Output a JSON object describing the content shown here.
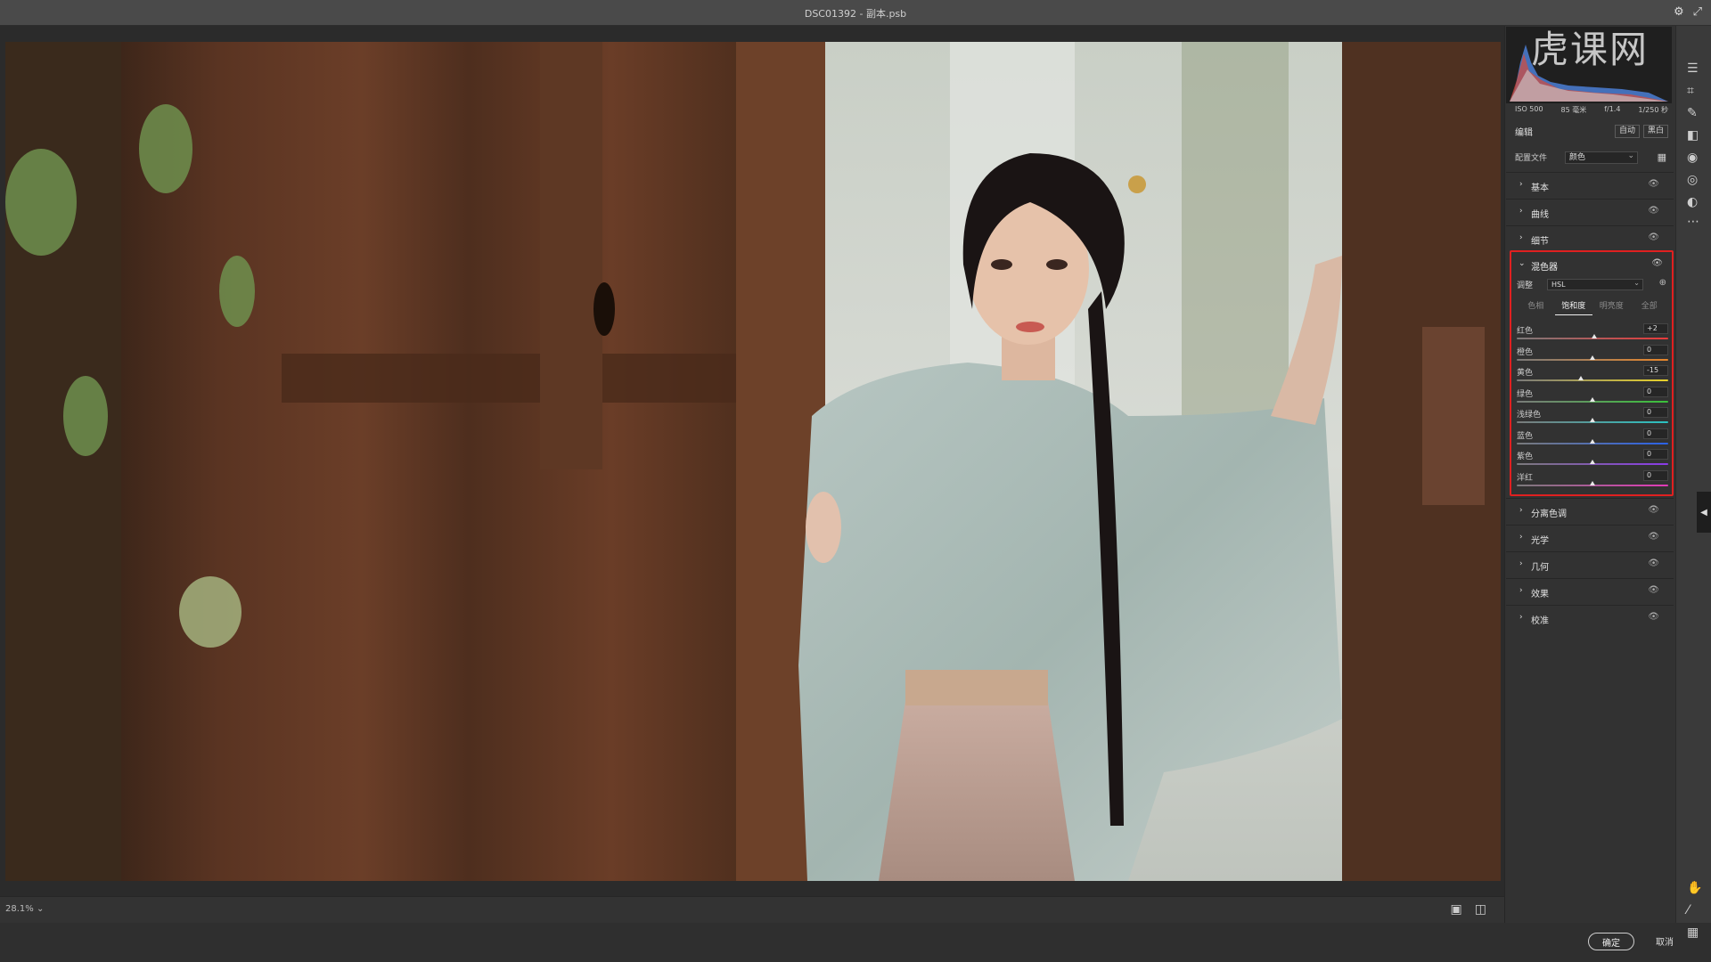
{
  "window": {
    "title": "DSC01392 - 副本.psb"
  },
  "watermark": "虎课网",
  "zoom": "28.1%",
  "exif": [
    "ISO 500",
    "85 毫米",
    "f/1.4",
    "1/250 秒"
  ],
  "panel": {
    "edit_label": "编辑",
    "auto_label": "自动",
    "bw_label": "黑白",
    "profile_label": "配置文件",
    "profile_value": "颜色",
    "sections_top": [
      {
        "label": "基本"
      },
      {
        "label": "曲线"
      },
      {
        "label": "细节"
      }
    ],
    "mixer": {
      "label": "混色器",
      "adjust_label": "调整",
      "adjust_value": "HSL",
      "tabs": [
        {
          "label": "色相",
          "active": false
        },
        {
          "label": "饱和度",
          "active": true
        },
        {
          "label": "明亮度",
          "active": false
        },
        {
          "label": "全部",
          "active": false
        }
      ],
      "sliders": [
        {
          "name": "红色",
          "value": "+2",
          "pos": 0.51,
          "grad": "linear-gradient(90deg,#7a7a7a,#e83a3a)"
        },
        {
          "name": "橙色",
          "value": "0",
          "pos": 0.5,
          "grad": "linear-gradient(90deg,#7a7a7a,#e8862a)"
        },
        {
          "name": "黄色",
          "value": "-15",
          "pos": 0.425,
          "grad": "linear-gradient(90deg,#7a7a7a,#e8d22a)"
        },
        {
          "name": "绿色",
          "value": "0",
          "pos": 0.5,
          "grad": "linear-gradient(90deg,#7a7a7a,#3ac23a)"
        },
        {
          "name": "浅绿色",
          "value": "0",
          "pos": 0.5,
          "grad": "linear-gradient(90deg,#7a7a7a,#2ac2c2)"
        },
        {
          "name": "蓝色",
          "value": "0",
          "pos": 0.5,
          "grad": "linear-gradient(90deg,#7a7a7a,#2a62e8)"
        },
        {
          "name": "紫色",
          "value": "0",
          "pos": 0.5,
          "grad": "linear-gradient(90deg,#7a7a7a,#8a3ae8)"
        },
        {
          "name": "洋红",
          "value": "0",
          "pos": 0.5,
          "grad": "linear-gradient(90deg,#7a7a7a,#e23ab8)"
        }
      ]
    },
    "sections_bottom": [
      {
        "label": "分离色调"
      },
      {
        "label": "光学"
      },
      {
        "label": "几何"
      },
      {
        "label": "效果"
      },
      {
        "label": "校准"
      }
    ]
  },
  "buttons": {
    "ok": "确定",
    "cancel": "取消"
  },
  "colors": {
    "highlight": "#e02020",
    "panel_bg": "#323232"
  }
}
